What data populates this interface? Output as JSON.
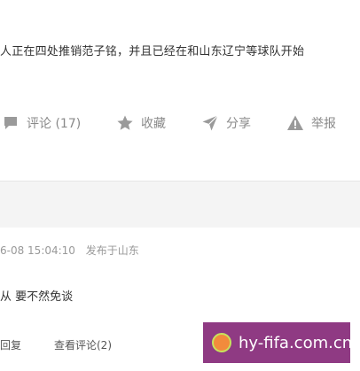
{
  "article": {
    "text_line": "人正在四处推销范子铭，并且已经在和山东辽宁等球队开始"
  },
  "actions": {
    "comment_label": "评论 (17)",
    "collect_label": "收藏",
    "share_label": "分享",
    "report_label": "举报"
  },
  "comment": {
    "timestamp": "6-08 15:04:10",
    "location": "发布于山东",
    "text": "从 要不然免谈",
    "reply_label": "回复",
    "view_replies_label": "查看评论(2)"
  },
  "watermark": {
    "text": "hy-fifa.com.cn"
  },
  "colors": {
    "action_gray": "#8a8a8a",
    "watermark_bg": "#8f3a83",
    "logo_orange": "#f28b3c"
  }
}
